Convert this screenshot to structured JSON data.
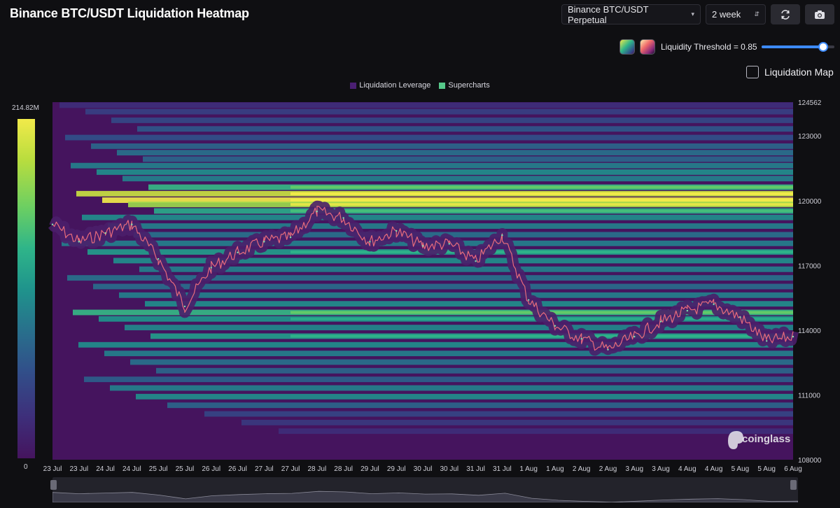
{
  "title": "Binance BTC/USDT Liquidation Heatmap",
  "toolbar": {
    "pair_select": "Binance BTC/USDT Perpetual",
    "range_select": "2 week",
    "refresh_icon": "refresh-icon",
    "camera_icon": "camera-icon"
  },
  "threshold": {
    "label": "Liquidity Threshold = 0.85",
    "value": 0.85,
    "colorscheme_swatches": [
      "viridis",
      "magma"
    ]
  },
  "liquidation_map": {
    "label": "Liquidation Map",
    "checked": false
  },
  "watermark": "coinglass",
  "chart_data": {
    "type": "heatmap",
    "title": "Binance BTC/USDT Liquidation Heatmap",
    "legend": [
      {
        "name": "Liquidation Leverage",
        "color": "#4b1f73"
      },
      {
        "name": "Supercharts",
        "color": "#56c98a"
      }
    ],
    "colorbar": {
      "max_label": "214.82M",
      "min_label": "0",
      "max": 214820000,
      "min": 0
    },
    "y_axis": {
      "ticks": [
        "124562",
        "123000",
        "120000",
        "117000",
        "114000",
        "111000",
        "108000"
      ],
      "range": [
        108000,
        124562
      ]
    },
    "x_axis": {
      "ticks": [
        "23 Jul",
        "23 Jul",
        "24 Jul",
        "24 Jul",
        "25 Jul",
        "25 Jul",
        "26 Jul",
        "26 Jul",
        "27 Jul",
        "27 Jul",
        "28 Jul",
        "28 Jul",
        "29 Jul",
        "29 Jul",
        "30 Jul",
        "30 Jul",
        "31 Jul",
        "31 Jul",
        "1 Aug",
        "1 Aug",
        "2 Aug",
        "2 Aug",
        "3 Aug",
        "3 Aug",
        "4 Aug",
        "4 Aug",
        "5 Aug",
        "5 Aug",
        "6 Aug"
      ]
    },
    "price_series": {
      "name": "BTC/USDT",
      "x": [
        "23 Jul",
        "23 Jul",
        "24 Jul",
        "24 Jul",
        "25 Jul",
        "25 Jul",
        "26 Jul",
        "26 Jul",
        "27 Jul",
        "27 Jul",
        "28 Jul",
        "28 Jul",
        "29 Jul",
        "29 Jul",
        "30 Jul",
        "30 Jul",
        "31 Jul",
        "31 Jul",
        "1 Aug",
        "1 Aug",
        "2 Aug",
        "2 Aug",
        "3 Aug",
        "3 Aug",
        "4 Aug",
        "4 Aug",
        "5 Aug",
        "5 Aug",
        "6 Aug"
      ],
      "y": [
        118900,
        118100,
        118500,
        118900,
        117300,
        115100,
        116900,
        117600,
        118100,
        118300,
        119500,
        119200,
        118100,
        118600,
        117900,
        118000,
        117200,
        118400,
        115400,
        114200,
        113600,
        113100,
        113700,
        114400,
        114900,
        115200,
        114600,
        113500,
        113700
      ]
    },
    "liquidity_bands": [
      {
        "price": 124400,
        "intensity": 0.2
      },
      {
        "price": 124100,
        "intensity": 0.28
      },
      {
        "price": 123700,
        "intensity": 0.32
      },
      {
        "price": 123300,
        "intensity": 0.38
      },
      {
        "price": 122900,
        "intensity": 0.35
      },
      {
        "price": 122500,
        "intensity": 0.45
      },
      {
        "price": 122200,
        "intensity": 0.5
      },
      {
        "price": 121900,
        "intensity": 0.45
      },
      {
        "price": 121600,
        "intensity": 0.55
      },
      {
        "price": 121300,
        "intensity": 0.6
      },
      {
        "price": 121000,
        "intensity": 0.55
      },
      {
        "price": 120600,
        "intensity": 0.75
      },
      {
        "price": 120300,
        "intensity": 0.95
      },
      {
        "price": 120000,
        "intensity": 1.0
      },
      {
        "price": 119800,
        "intensity": 0.9
      },
      {
        "price": 119500,
        "intensity": 0.7
      },
      {
        "price": 119200,
        "intensity": 0.6
      },
      {
        "price": 118800,
        "intensity": 0.55
      },
      {
        "price": 118400,
        "intensity": 0.5
      },
      {
        "price": 118000,
        "intensity": 0.55
      },
      {
        "price": 117600,
        "intensity": 0.65
      },
      {
        "price": 117200,
        "intensity": 0.6
      },
      {
        "price": 116800,
        "intensity": 0.55
      },
      {
        "price": 116400,
        "intensity": 0.5
      },
      {
        "price": 116000,
        "intensity": 0.48
      },
      {
        "price": 115600,
        "intensity": 0.55
      },
      {
        "price": 115200,
        "intensity": 0.6
      },
      {
        "price": 114800,
        "intensity": 0.75
      },
      {
        "price": 114500,
        "intensity": 0.62
      },
      {
        "price": 114100,
        "intensity": 0.58
      },
      {
        "price": 113700,
        "intensity": 0.65
      },
      {
        "price": 113300,
        "intensity": 0.6
      },
      {
        "price": 112900,
        "intensity": 0.55
      },
      {
        "price": 112500,
        "intensity": 0.5
      },
      {
        "price": 112100,
        "intensity": 0.45
      },
      {
        "price": 111700,
        "intensity": 0.42
      },
      {
        "price": 111300,
        "intensity": 0.55
      },
      {
        "price": 110900,
        "intensity": 0.6
      },
      {
        "price": 110500,
        "intensity": 0.45
      },
      {
        "price": 110100,
        "intensity": 0.3
      },
      {
        "price": 109700,
        "intensity": 0.25
      },
      {
        "price": 109300,
        "intensity": 0.2
      }
    ]
  }
}
